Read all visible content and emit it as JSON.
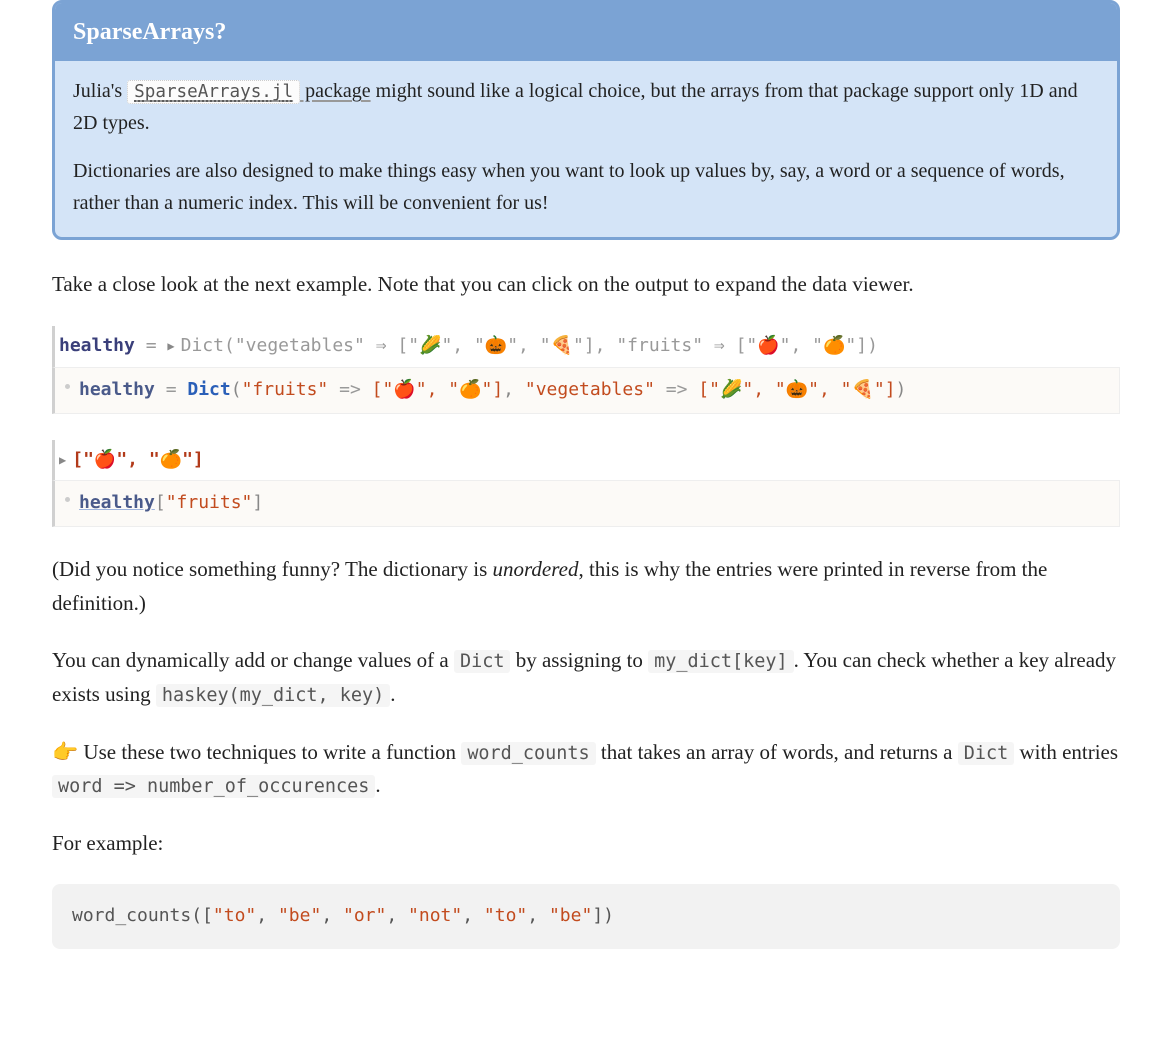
{
  "callout": {
    "title": "SparseArrays?",
    "link_code": "SparseArrays.jl",
    "link_text_suffix": " package",
    "para1_before": "Julia's ",
    "para1_after": " might sound like a logical choice, but the arrays from that package support only 1D and 2D types.",
    "para2": "Dictionaries are also designed to make things easy when you want to look up values by, say, a word or a sequence of words, rather than a numeric index. This will be convenient for us!"
  },
  "para_intro": "Take a close look at the next example. Note that you can click on the output to expand the data viewer.",
  "cell1": {
    "out": {
      "id": "healthy",
      "eq": " = ",
      "fn": "Dict",
      "open": "(",
      "k1": "\"vegetables\"",
      "arrow": " ⇒ ",
      "v1": "[\"🌽\", \"🎃\", \"🍕\"]",
      "sep": ", ",
      "k2": "\"fruits\"",
      "v2": "[\"🍎\", \"🍊\"]",
      "close": ")"
    },
    "in": {
      "id": "healthy",
      "eq": " = ",
      "fn": "Dict",
      "open": "(",
      "k1": "\"fruits\"",
      "arrow": " => ",
      "v1": "[\"🍎\", \"🍊\"]",
      "sep": ", ",
      "k2": "\"vegetables\"",
      "v2": "[\"🌽\", \"🎃\", \"🍕\"]",
      "close": ")"
    }
  },
  "cell2": {
    "out": "[\"🍎\", \"🍊\"]",
    "in": {
      "id": "healthy",
      "open": "[",
      "key": "\"fruits\"",
      "close": "]"
    }
  },
  "para_unordered_before": "(Did you notice something funny? The dictionary is ",
  "para_unordered_em": "unordered",
  "para_unordered_after": ", this is why the entries were printed in reverse from the definition.)",
  "para_dyn_1": "You can dynamically add or change values of a ",
  "code_dict": "Dict",
  "para_dyn_2": " by assigning to ",
  "code_mykey": "my_dict[key]",
  "para_dyn_3": ". You can check whether a key already exists using ",
  "code_haskey": "haskey(my_dict, key)",
  "para_dyn_4": ".",
  "hand_emoji": "👉",
  "para_task_1": " Use these two techniques to write a function ",
  "code_wc": "word_counts",
  "para_task_2": " that takes an array of words, and returns a ",
  "para_task_3": " with entries ",
  "code_entry": "word => number_of_occurences",
  "para_task_4": ".",
  "for_example": "For example:",
  "example_code": {
    "fn": "word_counts",
    "open": "([",
    "s1": "\"to\"",
    "s2": "\"be\"",
    "s3": "\"or\"",
    "s4": "\"not\"",
    "s5": "\"to\"",
    "s6": "\"be\"",
    "close": "])",
    "comma": ", "
  }
}
